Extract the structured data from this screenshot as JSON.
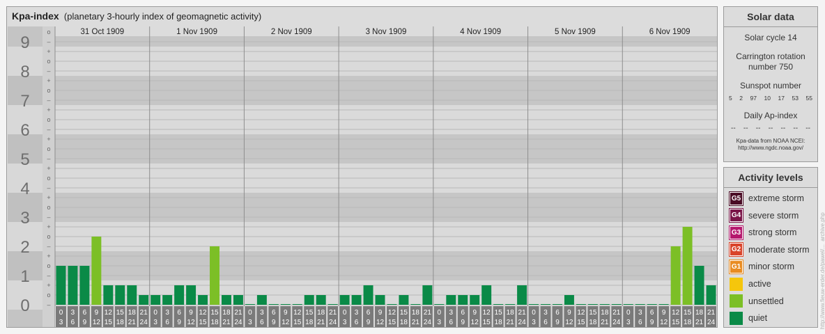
{
  "header": {
    "title": "Kpa-index",
    "subtitle": "(planetary 3-hourly index of geomagnetic activity)"
  },
  "chart_data": {
    "type": "bar",
    "y_axis": {
      "labels": [
        "0",
        "1",
        "2",
        "3",
        "4",
        "5",
        "6",
        "7",
        "8",
        "9"
      ],
      "minor_marks": [
        "–",
        "o",
        "+"
      ],
      "ylim": [
        0,
        9.33
      ]
    },
    "days": [
      "31 Oct 1909",
      "1 Nov 1909",
      "2 Nov 1909",
      "3 Nov 1909",
      "4 Nov 1909",
      "5 Nov 1909",
      "6 Nov 1909"
    ],
    "intervals": [
      {
        "start": "0",
        "end": "3"
      },
      {
        "start": "3",
        "end": "6"
      },
      {
        "start": "6",
        "end": "9"
      },
      {
        "start": "9",
        "end": "12"
      },
      {
        "start": "12",
        "end": "15"
      },
      {
        "start": "15",
        "end": "18"
      },
      {
        "start": "18",
        "end": "21"
      },
      {
        "start": "21",
        "end": "24"
      }
    ],
    "series": [
      {
        "values": [
          1.333,
          1.333,
          1.333,
          2.333,
          0.667,
          0.667,
          0.667,
          0.333,
          0.333,
          0.333,
          0.667,
          0.667,
          0.333,
          2.0,
          0.333,
          0.333,
          0,
          0.333,
          0,
          0,
          0,
          0.333,
          0.333,
          0,
          0.333,
          0.333,
          0.667,
          0.333,
          0,
          0.333,
          0,
          0.667,
          0,
          0.333,
          0.333,
          0.333,
          0.667,
          0,
          0,
          0.667,
          0,
          0,
          0,
          0.333,
          0,
          0,
          0,
          0,
          0,
          0,
          0,
          0,
          2.0,
          2.667,
          1.333,
          0.667
        ]
      }
    ],
    "legend": [
      {
        "code": "G5",
        "label": "extreme storm",
        "color": "#4a0c25"
      },
      {
        "code": "G4",
        "label": "severe storm",
        "color": "#7a1548"
      },
      {
        "code": "G3",
        "label": "strong storm",
        "color": "#b5176d"
      },
      {
        "code": "G2",
        "label": "moderate storm",
        "color": "#d9442a"
      },
      {
        "code": "G1",
        "label": "minor storm",
        "color": "#e98c22"
      },
      {
        "code": "",
        "label": "active",
        "color": "#f5c60c"
      },
      {
        "code": "",
        "label": "unsettled",
        "color": "#7cbf26"
      },
      {
        "code": "",
        "label": "quiet",
        "color": "#0a8a47"
      }
    ]
  },
  "solar": {
    "title": "Solar data",
    "cycle": "Solar cycle 14",
    "carrington": "Carrington rotation number 750",
    "sunspot_title": "Sunspot number",
    "sunspots": [
      "5",
      "2",
      "97",
      "10",
      "17",
      "53",
      "55"
    ],
    "ap_title": "Daily Ap-index",
    "ap_values": [
      "--",
      "--",
      "--",
      "--",
      "--",
      "--",
      "--"
    ],
    "source_line1": "Kpa-data from NOAA NCEI:",
    "source_line2": "http://www.ngdc.noaa.gov/"
  },
  "activity": {
    "title": "Activity levels"
  },
  "credit": "http://www.fieuw-erder.de/pawel/..._archive.php"
}
